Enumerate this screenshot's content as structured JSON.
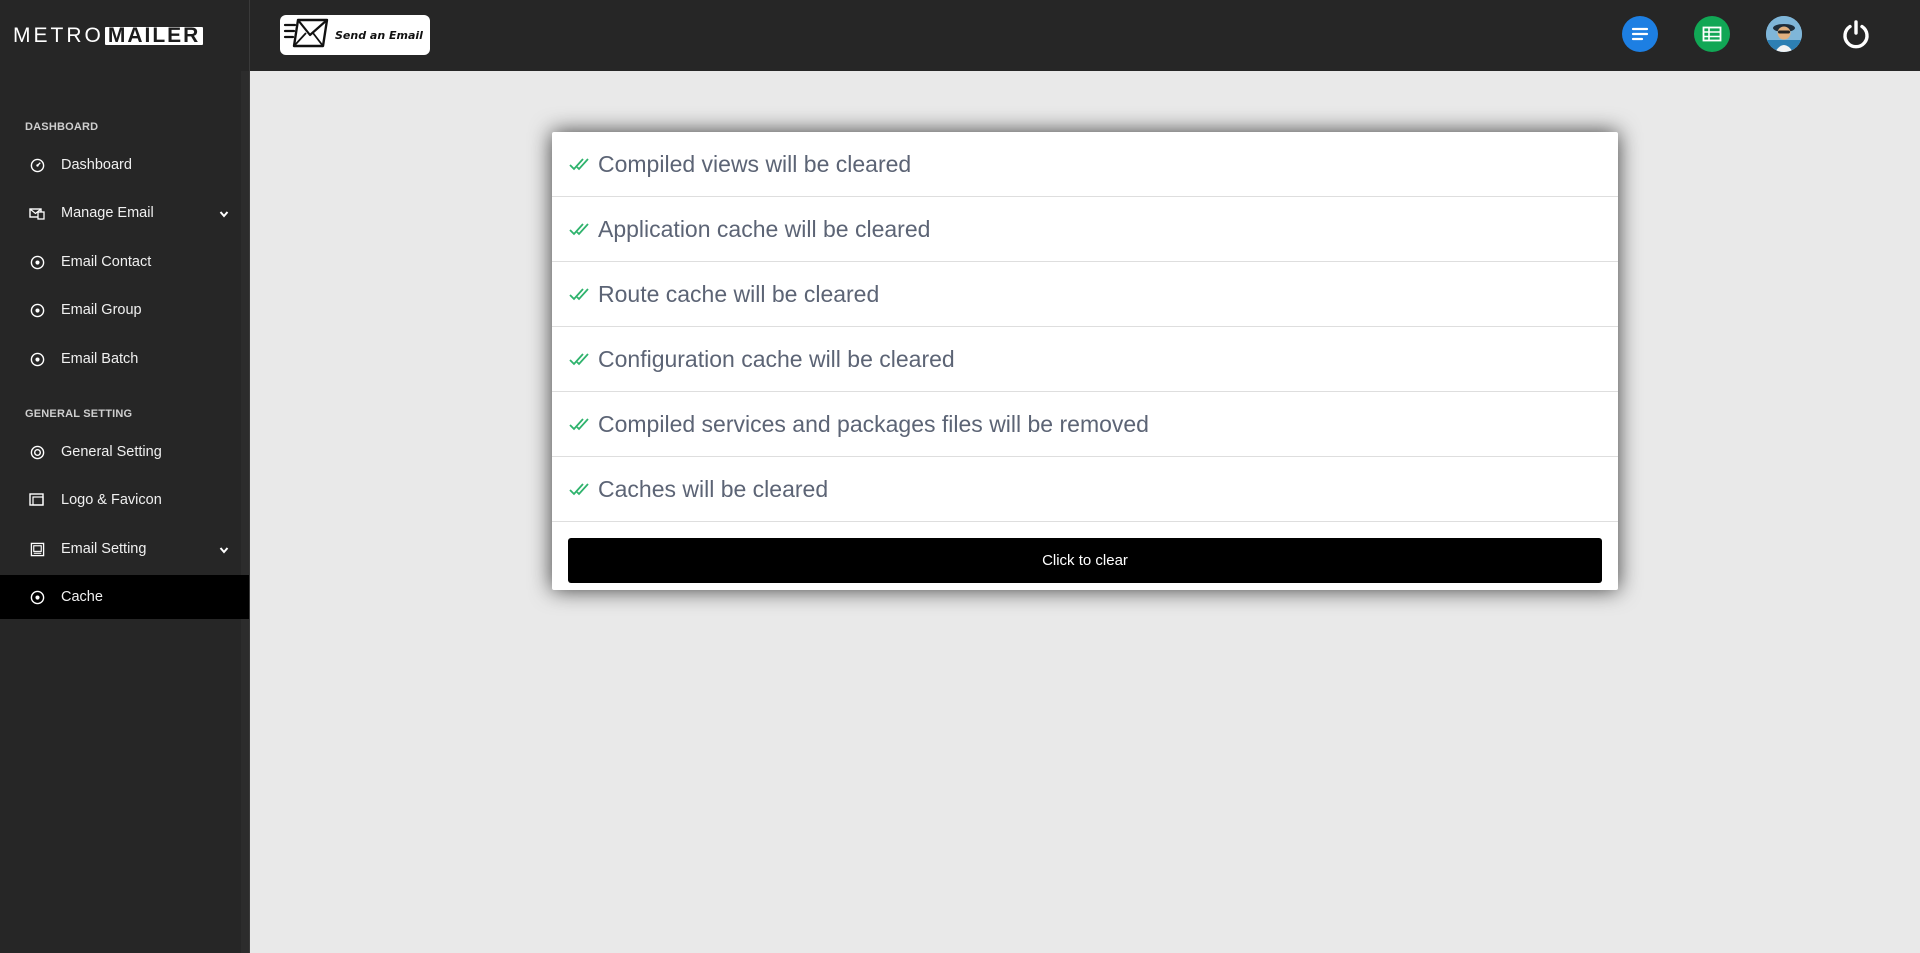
{
  "brand": {
    "part1": "METRO",
    "part2": "MAILER"
  },
  "topbar": {
    "send_email_label": "Send an Email",
    "icons": [
      "menu-icon",
      "spreadsheet-icon",
      "avatar",
      "power-icon"
    ],
    "colors": {
      "menu": "#1d7fe3",
      "sheet": "#11a755"
    }
  },
  "sidebar": {
    "sections": [
      {
        "title": "DASHBOARD"
      },
      {
        "title": "GENERAL SETTING"
      }
    ],
    "items": [
      {
        "label": "Dashboard",
        "icon": "gauge-icon"
      },
      {
        "label": "Manage Email",
        "icon": "mail-stack-icon",
        "dropdown": true
      },
      {
        "label": "Email Contact",
        "icon": "circle-dot-icon"
      },
      {
        "label": "Email Group",
        "icon": "circle-dot-icon"
      },
      {
        "label": "Email Batch",
        "icon": "circle-dot-icon"
      },
      {
        "label": "General Setting",
        "icon": "lifebuoy-icon"
      },
      {
        "label": "Logo & Favicon",
        "icon": "image-stack-icon"
      },
      {
        "label": "Email Setting",
        "icon": "image-icon",
        "dropdown": true
      },
      {
        "label": "Cache",
        "icon": "circle-dot-icon",
        "active": true
      }
    ]
  },
  "cache": {
    "items": [
      "Compiled views will be cleared",
      "Application cache will be cleared",
      "Route cache will be cleared",
      "Configuration cache will be cleared",
      "Compiled services and packages files will be removed",
      "Caches will be cleared"
    ],
    "button_label": "Click to clear",
    "check_color": "#2fb36d"
  }
}
